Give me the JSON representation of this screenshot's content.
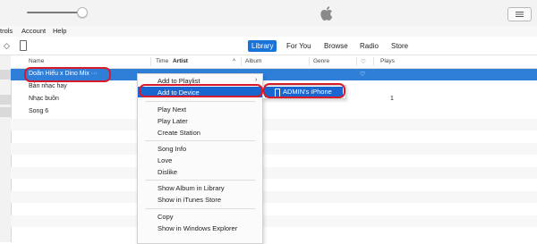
{
  "menubar": {
    "items": [
      "trols",
      "Account",
      "Help"
    ]
  },
  "nav": {
    "tabs": [
      {
        "label": "Library",
        "active": true
      },
      {
        "label": "For You",
        "active": false
      },
      {
        "label": "Browse",
        "active": false
      },
      {
        "label": "Radio",
        "active": false
      },
      {
        "label": "Store",
        "active": false
      }
    ]
  },
  "table": {
    "headers": {
      "name": "Name",
      "time": "Time",
      "artist": "Artist",
      "album": "Album",
      "genre": "Genre",
      "plays": "Plays"
    },
    "rows": [
      {
        "name": "Doãn Hiếu x Dino Mix ···",
        "plays": ""
      },
      {
        "name": "Bản nhạc hay",
        "plays": ""
      },
      {
        "name": "Nhạc buồn",
        "plays": "1"
      },
      {
        "name": "Song 6",
        "plays": ""
      }
    ]
  },
  "context_menu": {
    "items": [
      "Add to Playlist",
      "Add to Device",
      "Play Next",
      "Play Later",
      "Create Station",
      "Song Info",
      "Love",
      "Dislike",
      "Show Album in Library",
      "Show in iTunes Store",
      "Copy",
      "Show in Windows Explorer"
    ],
    "highlighted": "Add to Device"
  },
  "submenu": {
    "device_label": "ADMIN's iPhone"
  },
  "colors": {
    "accent": "#1a73d9",
    "selection": "#2f7fd8",
    "annotation": "#d81b2b"
  },
  "icons": [
    "apple-logo-icon",
    "list-view-icon",
    "chevron-icon",
    "iphone-icon",
    "heart-icon",
    "sort-caret-icon",
    "submenu-arrow-icon"
  ]
}
